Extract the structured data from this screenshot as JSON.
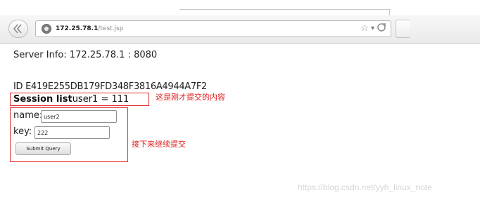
{
  "browser": {
    "url_host": "172.25.78.1",
    "url_path": "/test.jsp",
    "icons": [
      "back-icon",
      "site-identity-icon",
      "star-icon",
      "dropdown-icon",
      "reload-icon"
    ]
  },
  "page": {
    "server_info": "Server Info: 172.25.78.1 : 8080",
    "session_id": "ID E419E255DB179FD348F3816A4944A7F2",
    "session_list_label": "Session list",
    "session_list_value": "user1 = 111",
    "form": {
      "name_label": "name:",
      "name_value": "user2",
      "key_label": "key:",
      "key_value": "222",
      "submit_label": "Submit Query"
    }
  },
  "annotations": {
    "note_submitted": "这是刚才提交的内容",
    "note_continue": "接下来继续提交",
    "highlight_color": "#e03030"
  },
  "watermark": "https://blog.csdn.net/yyh_linux_note"
}
